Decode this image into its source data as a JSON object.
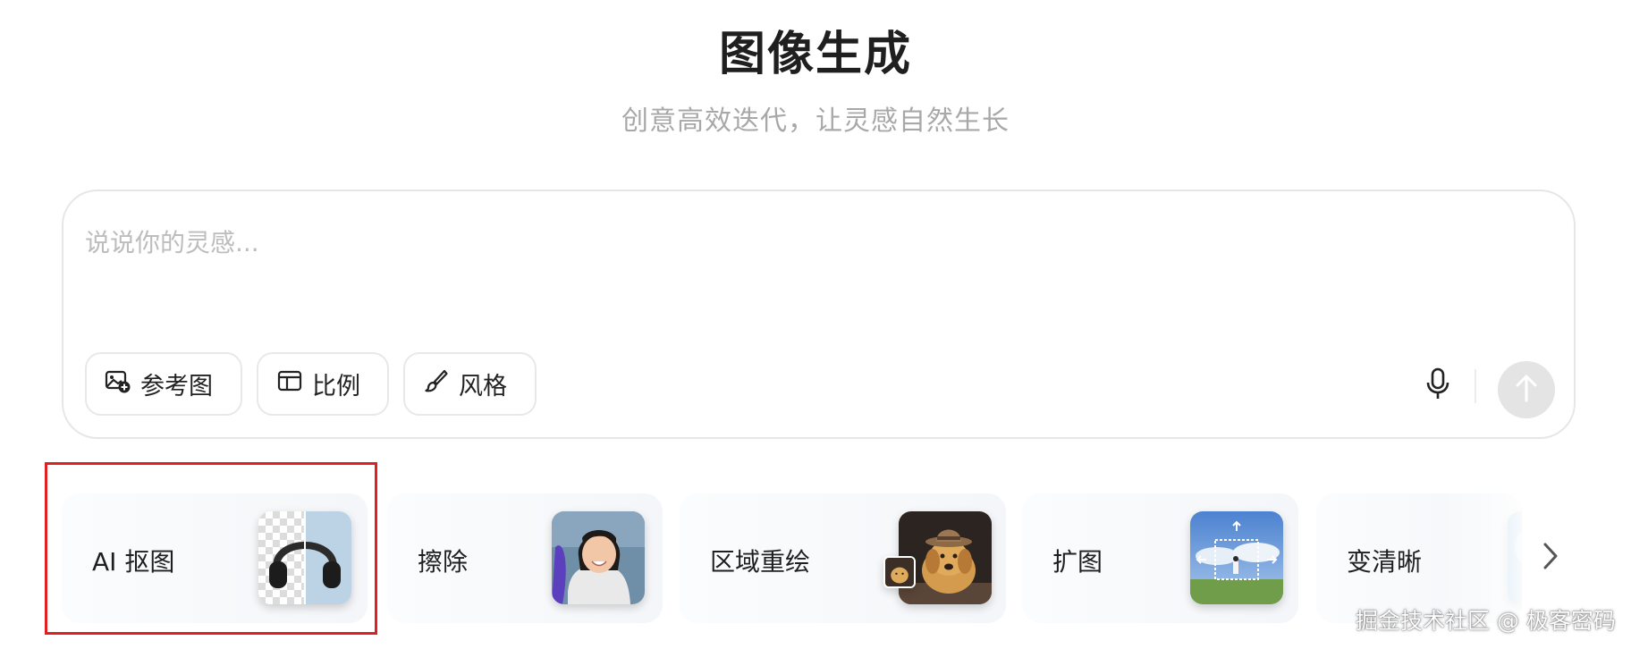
{
  "header": {
    "title": "图像生成",
    "subtitle": "创意高效迭代，让灵感自然生长"
  },
  "prompt": {
    "placeholder": "说说你的灵感...",
    "value": "",
    "chips": [
      {
        "label": "参考图",
        "icon": "image-add-icon"
      },
      {
        "label": "比例",
        "icon": "layout-ratio-icon"
      },
      {
        "label": "风格",
        "icon": "brush-icon"
      }
    ],
    "mic_icon": "microphone-icon",
    "send_icon": "arrow-up-icon"
  },
  "tools": [
    {
      "label": "AI 抠图",
      "thumb": "headphones-cutout-image"
    },
    {
      "label": "擦除",
      "thumb": "smiling-girl-image"
    },
    {
      "label": "区域重绘",
      "thumb": "dog-with-hat-image"
    },
    {
      "label": "扩图",
      "thumb": "expand-landscape-image"
    },
    {
      "label": "变清晰",
      "thumb": "sharpen-preview-image"
    }
  ],
  "next_icon": "chevron-right-icon",
  "watermark": "掘金技术社区 @ 极客密码",
  "colors": {
    "highlight": "#e02020",
    "placeholder": "#bdbdbd",
    "send_disabled": "#e4e4e4"
  }
}
